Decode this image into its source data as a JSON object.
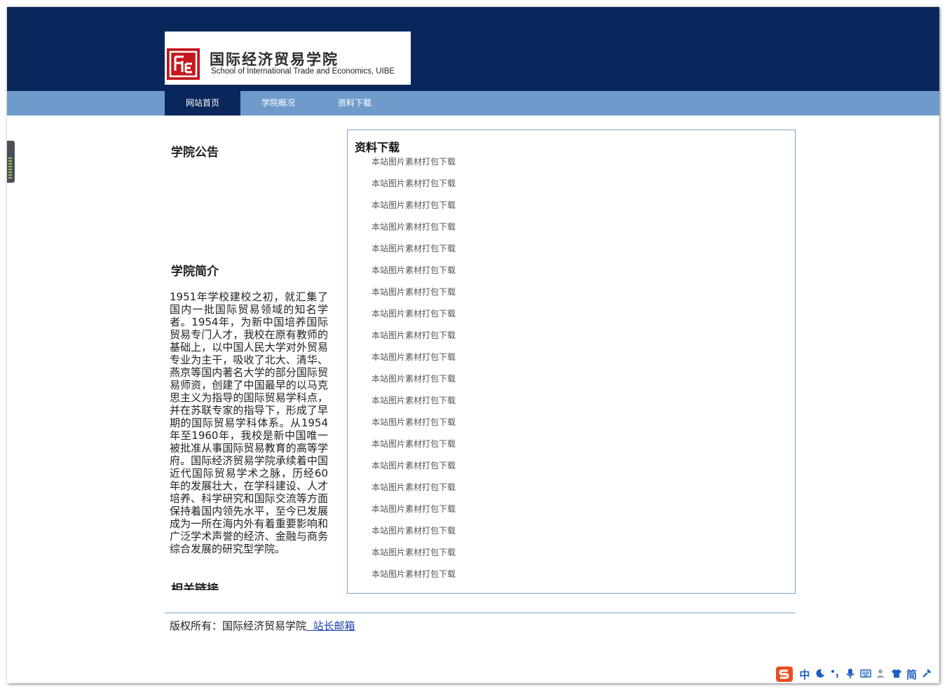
{
  "logo": {
    "cn_name": "国际经济贸易学院",
    "en_name": "School of International Trade and Economics, UIBE"
  },
  "nav": {
    "items": [
      {
        "label": "网站首页",
        "active": true
      },
      {
        "label": "学院概况",
        "active": false
      },
      {
        "label": "资料下载",
        "active": false
      }
    ]
  },
  "sidebar": {
    "announcements_title": "学院公告",
    "intro_title": "学院简介",
    "intro_text": "1951年学校建校之初，就汇集了国内一批国际贸易领域的知名学者。1954年，为新中国培养国际贸易专门人才，我校在原有教师的基础上，以中国人民大学对外贸易专业为主干，吸收了北大、清华、燕京等国内著名大学的部分国际贸易师资，创建了中国最早的以马克思主义为指导的国际贸易学科点，并在苏联专家的指导下，形成了早期的国际贸易学科体系。从1954年至1960年，我校是新中国唯一被批准从事国际贸易教育的高等学府。国际经济贸易学院承续着中国近代国际贸易学术之脉，历经60年的发展壮大，在学科建设、人才培养、科学研究和国际交流等方面保持着国内领先水平，至今已发展成为一所在海内外有着重要影响和广泛学术声誉的经济、金融与商务综合发展的研究型学院。",
    "links_title": "相关链接"
  },
  "downloads": {
    "title": "资料下载",
    "items": [
      "本站图片素材打包下载",
      "本站图片素材打包下载",
      "本站图片素材打包下载",
      "本站图片素材打包下载",
      "本站图片素材打包下载",
      "本站图片素材打包下载",
      "本站图片素材打包下载",
      "本站图片素材打包下载",
      "本站图片素材打包下载",
      "本站图片素材打包下载",
      "本站图片素材打包下载",
      "本站图片素材打包下载",
      "本站图片素材打包下载",
      "本站图片素材打包下载",
      "本站图片素材打包下载",
      "本站图片素材打包下载",
      "本站图片素材打包下载",
      "本站图片素材打包下载",
      "本站图片素材打包下载",
      "本站图片素材打包下载"
    ]
  },
  "footer": {
    "copyright": "版权所有：国际经济贸易学院",
    "mail_link": "  站长邮箱"
  },
  "ime": {
    "lang": "中",
    "simplified": "简"
  },
  "colors": {
    "header_bg": "#0a275b",
    "nav_bg": "#6f9bcb",
    "nav_active_bg": "#0a275b",
    "logo_red": "#c4161c",
    "box_border": "#7ba3cf",
    "link": "#1a3fb0"
  }
}
